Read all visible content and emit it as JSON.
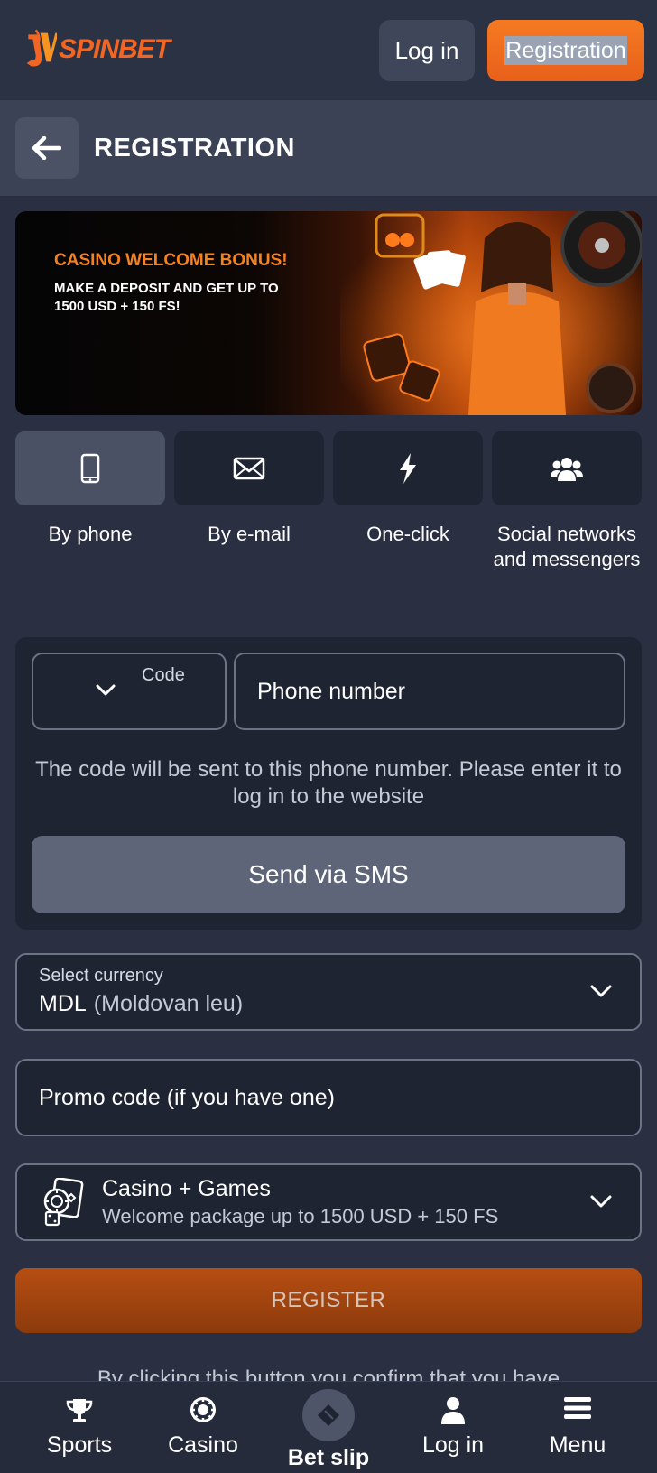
{
  "header": {
    "logo_text": "SPINBET",
    "login_label": "Log in",
    "register_label": "Registration"
  },
  "title_bar": {
    "title": "REGISTRATION"
  },
  "banner": {
    "title": "CASINO WELCOME BONUS!",
    "subtitle": "MAKE A DEPOSIT AND GET UP TO 1500 USD + 150 FS!"
  },
  "tabs": [
    {
      "label": "By phone",
      "icon": "phone-icon",
      "active": true
    },
    {
      "label": "By e-mail",
      "icon": "envelope-icon",
      "active": false
    },
    {
      "label": "One-click",
      "icon": "lightning-icon",
      "active": false
    },
    {
      "label": "Social networks and messengers",
      "icon": "users-icon",
      "active": false
    }
  ],
  "phone_form": {
    "code_label": "Code",
    "phone_placeholder": "Phone number",
    "note": "The code will be sent to this phone number. Please enter it to log in to the website",
    "sms_button": "Send via SMS"
  },
  "currency": {
    "label": "Select currency",
    "code": "MDL",
    "name": "(Moldovan leu)"
  },
  "promo": {
    "placeholder": "Promo code (if you have one)"
  },
  "bonus": {
    "title": "Casino + Games",
    "subtitle": "Welcome package up to 1500 USD + 150 FS"
  },
  "register_button": "REGISTER",
  "disclaimer": "By clicking this button you confirm that you have",
  "bottom_nav": [
    {
      "label": "Sports",
      "icon": "trophy-icon"
    },
    {
      "label": "Casino",
      "icon": "chip-icon"
    },
    {
      "label": "Bet slip",
      "icon": "ticket-icon"
    },
    {
      "label": "Log in",
      "icon": "user-icon"
    },
    {
      "label": "Menu",
      "icon": "hamburger-icon"
    }
  ],
  "colors": {
    "accent": "#f57a22",
    "background": "#2a3042",
    "card": "#1f2433"
  }
}
